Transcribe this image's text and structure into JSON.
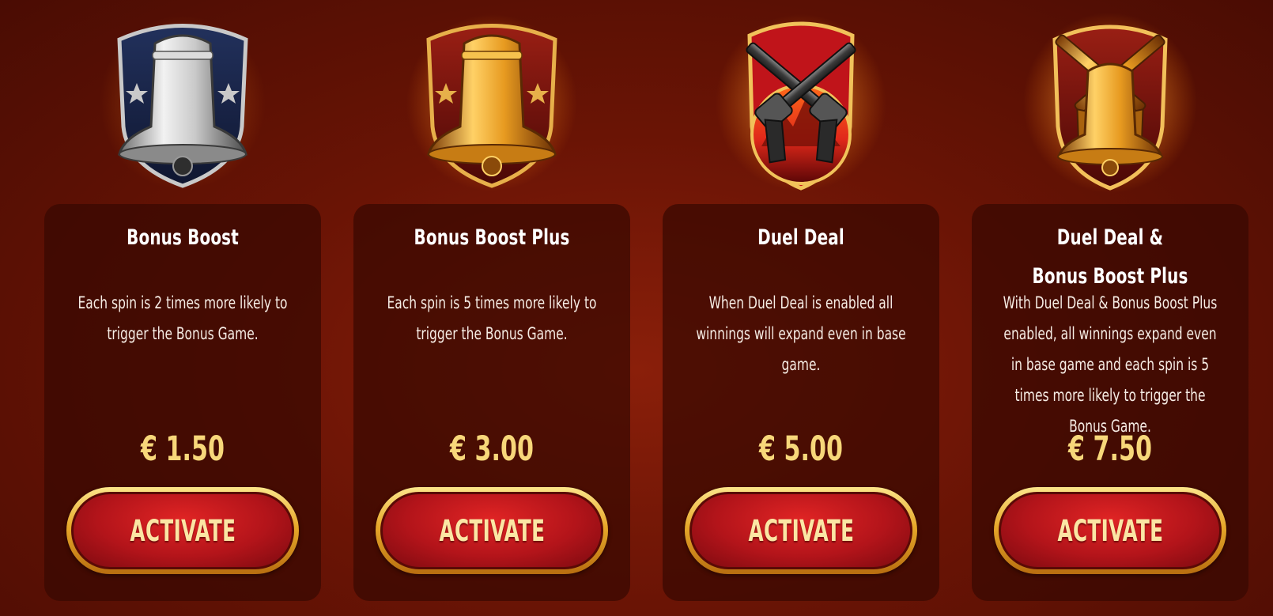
{
  "colors": {
    "background": "#6a1405",
    "card": "#3a0802",
    "price": "#f7d77a",
    "button_red": "#b3141a",
    "button_gold": "#e7a82a"
  },
  "cards": [
    {
      "icon": "silver-bell-badge-icon",
      "title": "Bonus Boost",
      "description": "Each spin is 2 times more likely to trigger the Bonus Game.",
      "price": "€ 1.50",
      "button_label": "ACTIVATE"
    },
    {
      "icon": "gold-bell-badge-icon",
      "title": "Bonus Boost Plus",
      "description": "Each spin is 5 times more likely to trigger the Bonus Game.",
      "price": "€ 3.00",
      "button_label": "ACTIVATE"
    },
    {
      "icon": "crossed-revolvers-badge-icon",
      "title": "Duel Deal",
      "description": "When Duel Deal is enabled all winnings will expand even in base game.",
      "price": "€ 5.00",
      "button_label": "ACTIVATE"
    },
    {
      "icon": "gold-bell-crossed-revolvers-badge-icon",
      "title": "Duel Deal & Bonus Boost Plus",
      "description": "With Duel Deal & Bonus Boost Plus enabled, all winnings expand even in base game and each spin is 5 times more likely to trigger the Bonus Game.",
      "price": "€ 7.50",
      "button_label": "ACTIVATE"
    }
  ]
}
